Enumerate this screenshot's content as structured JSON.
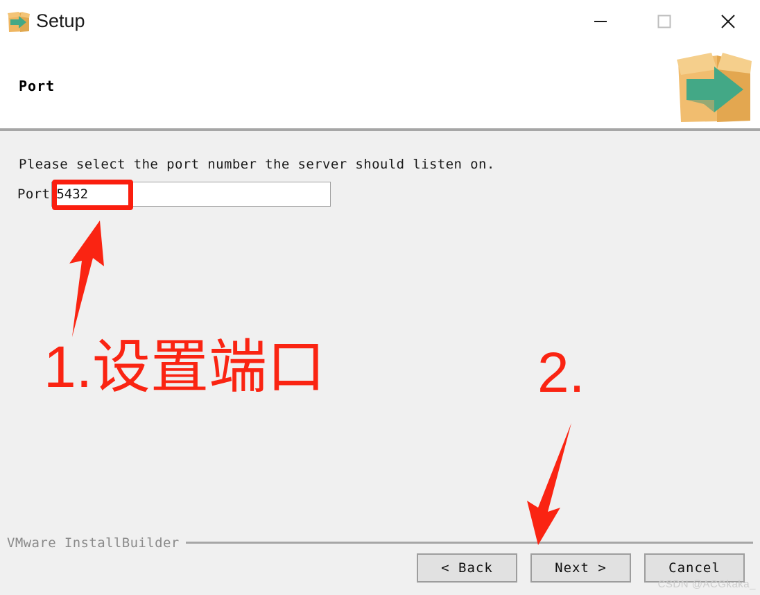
{
  "window": {
    "title": "Setup",
    "icon": "installer-box-arrow-icon",
    "controls": {
      "minimize": "minimize-icon",
      "maximize": "maximize-icon",
      "close": "close-icon"
    }
  },
  "header": {
    "title": "Port",
    "logo": "installer-box-arrow-logo"
  },
  "main": {
    "instruction": "Please select the port number the server should listen on.",
    "port_label": "Port",
    "port_value": "5432",
    "port_placeholder": ""
  },
  "footer": {
    "brand": "VMware InstallBuilder",
    "buttons": {
      "back": "< Back",
      "next": "Next >",
      "cancel": "Cancel"
    },
    "watermark": "CSDN @ACGkaka_"
  },
  "annotations": {
    "color": "#fa2412",
    "step1_text": "1.设置端口",
    "step2_text": "2.",
    "highlight_target": "port-input",
    "arrow1_target": "port-input",
    "arrow2_target": "next-button"
  },
  "colors": {
    "titlebar_bg": "#ffffff",
    "body_bg": "#f0f0f0",
    "divider": "#a6a6a6",
    "button_bg": "#e1e1e1",
    "button_border": "#9d9d9d",
    "annotation_red": "#fa2412",
    "box_orange": "#efb661",
    "arrow_green": "#43a886"
  }
}
